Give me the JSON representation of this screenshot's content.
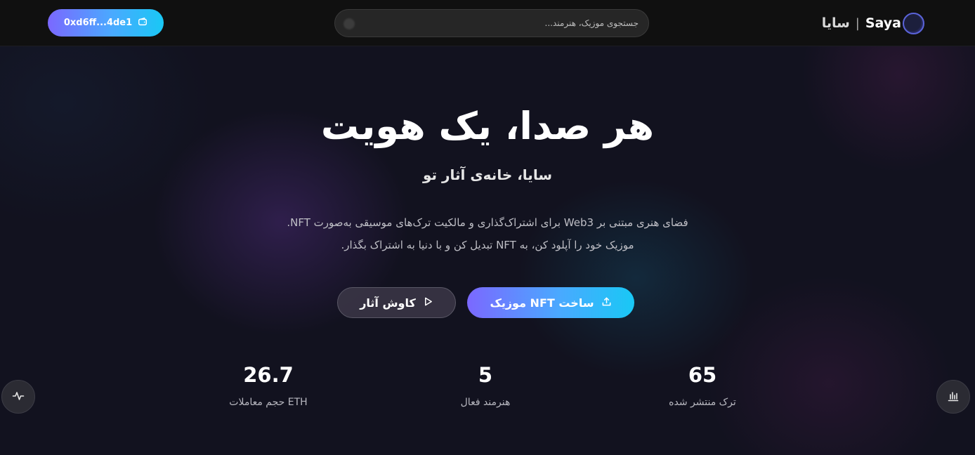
{
  "header": {
    "brand_en": "Saya",
    "brand_separator": "|",
    "brand_fa": "سایا",
    "search_placeholder": "جستجوی موزیک، هنرمند...",
    "wallet_address": "0xd6ff...4de1"
  },
  "hero": {
    "title": "هر صدا، یک هویت",
    "subtitle": "سایا، خانه‌ی آثار تو",
    "description_line1": "فضای هنری مبتنی بر Web3 برای اشتراک‌گذاری و مالکیت ترک‌های موسیقی به‌صورت NFT.",
    "description_line2": "موزیک خود را آپلود کن، به NFT تبدیل کن و با دنیا به اشتراک بگذار.",
    "primary_button": "ساخت NFT موزیک",
    "secondary_button": "کاوش آثار"
  },
  "stats": [
    {
      "value": "65",
      "label": "ترک منتشر شده"
    },
    {
      "value": "5",
      "label": "هنرمند فعال"
    },
    {
      "value": "26.7",
      "label": "ETH حجم معاملات"
    }
  ],
  "icons": {
    "wallet": "wallet-icon",
    "upload": "upload-icon",
    "play": "play-icon",
    "activity": "activity-icon",
    "chart": "bar-chart-icon"
  },
  "colors": {
    "accent_start": "#7b68ff",
    "accent_end": "#19c8f5",
    "background": "#12121f"
  }
}
